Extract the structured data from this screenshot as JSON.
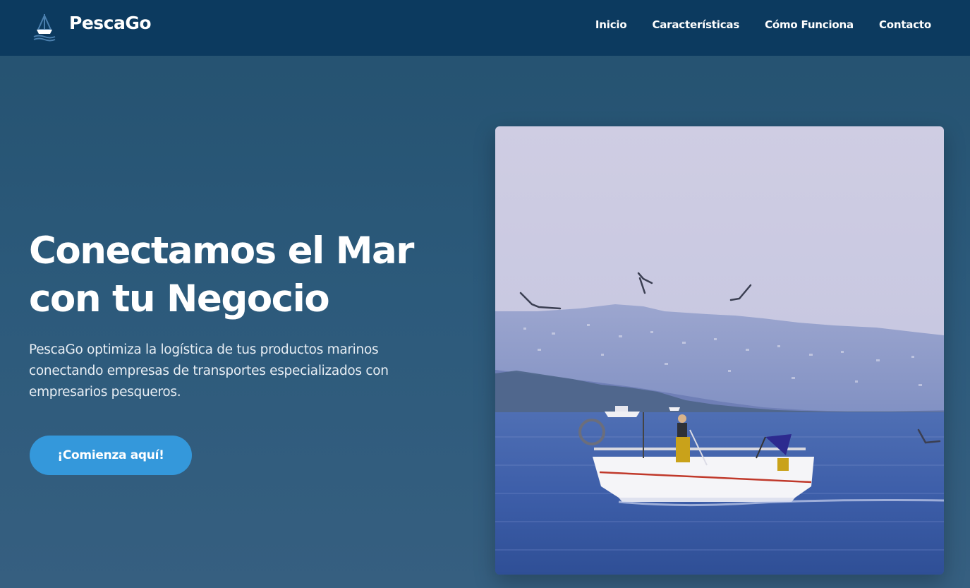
{
  "header": {
    "brand": "PescaGo",
    "logo_icon": "sailboat-icon",
    "nav": [
      {
        "label": "Inicio"
      },
      {
        "label": "Características"
      },
      {
        "label": "Cómo Funciona"
      },
      {
        "label": "Contacto"
      }
    ]
  },
  "hero": {
    "title_line1": "Conectamos el Mar",
    "title_line2": "con tu Negocio",
    "description": "PescaGo optimiza la logística de tus productos marinos conectando empresas de transportes especializados con empresarios pesqueros.",
    "cta_label": "¡Comienza aquí!"
  },
  "colors": {
    "navbar": "#0c3a5f",
    "background": "#2c5a7b",
    "accent": "#3498db",
    "text": "#ffffff"
  }
}
